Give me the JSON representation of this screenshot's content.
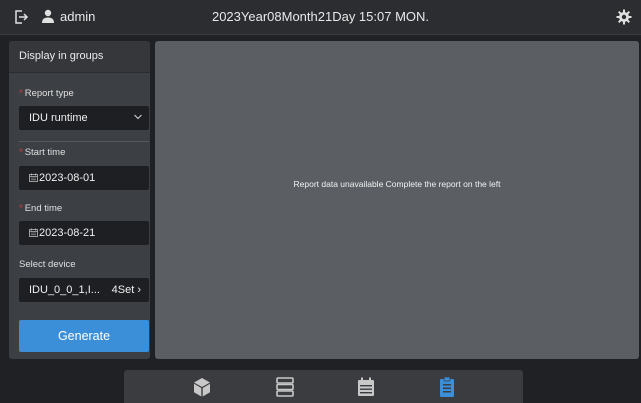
{
  "header": {
    "username": "admin",
    "datetime": "2023Year08Month21Day 15:07 MON.",
    "icons": [
      "logout-icon",
      "user-icon",
      "settings-icon"
    ]
  },
  "left_panel": {
    "title": "Display in groups",
    "report_type": {
      "label": "Report type",
      "value": "IDU runtime"
    },
    "start_time": {
      "label": "Start time",
      "value": "2023-08-01"
    },
    "end_time": {
      "label": "End time",
      "value": "2023-08-21"
    },
    "select_device": {
      "label": "Select device",
      "value": "IDU_0_0_1,I...",
      "count": "4Set"
    },
    "generate_label": "Generate"
  },
  "main": {
    "empty_message": "Report data unavailable Complete the report on the left"
  },
  "bottom_nav": {
    "items": [
      "cube-icon",
      "list-icon",
      "calendar-icon",
      "report-icon"
    ],
    "active": "report-icon",
    "active_color": "#3b8fd8"
  },
  "colors": {
    "accent": "#3b8fd8",
    "required": "#d23b3b"
  }
}
